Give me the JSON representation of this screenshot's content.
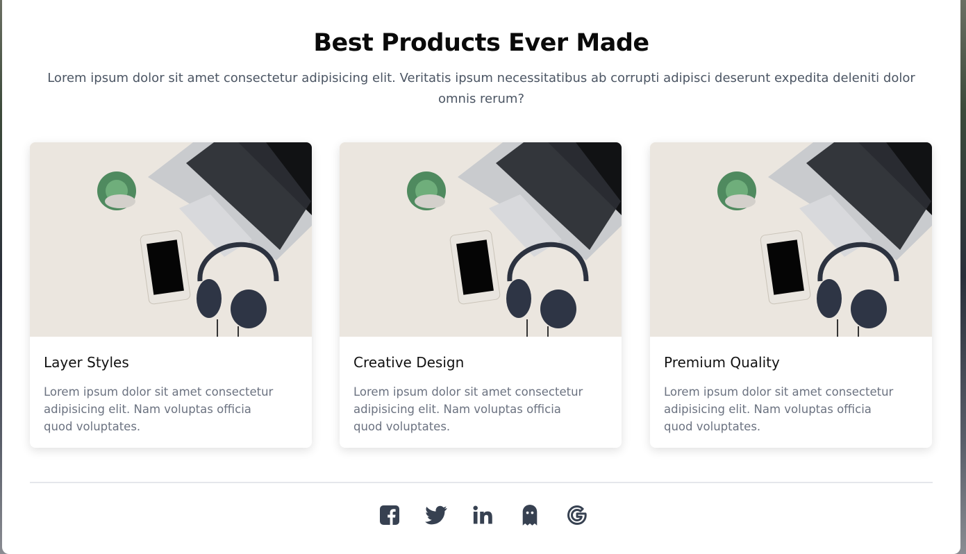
{
  "section": {
    "title": "Best Products Ever Made",
    "subtitle": "Lorem ipsum dolor sit amet consectetur adipisicing elit. Veritatis ipsum necessitatibus ab corrupti adipisci deserunt expedita deleniti dolor omnis rerum?"
  },
  "cards": [
    {
      "title": "Layer Styles",
      "description": "Lorem ipsum dolor sit amet consectetur adipisicing elit. Nam voluptas officia quod voluptates.",
      "image": "desk-laptop-phone-headphones-photo"
    },
    {
      "title": "Creative Design",
      "description": "Lorem ipsum dolor sit amet consectetur adipisicing elit. Nam voluptas officia quod voluptates.",
      "image": "desk-laptop-phone-headphones-photo"
    },
    {
      "title": "Premium Quality",
      "description": "Lorem ipsum dolor sit amet consectetur adipisicing elit. Nam voluptas officia quod voluptates.",
      "image": "desk-laptop-phone-headphones-photo"
    }
  ],
  "socials": [
    {
      "icon": "facebook-icon"
    },
    {
      "icon": "twitter-icon"
    },
    {
      "icon": "linkedin-icon"
    },
    {
      "icon": "snapchat-icon"
    },
    {
      "icon": "google-icon"
    }
  ],
  "colors": {
    "icon": "#374151",
    "heading": "#0a0a0a",
    "body_text": "#6b7280"
  }
}
